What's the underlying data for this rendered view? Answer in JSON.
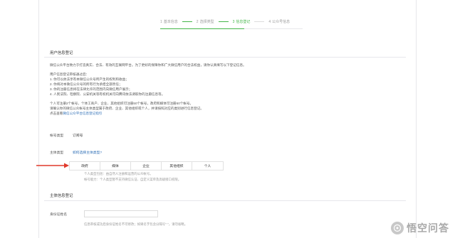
{
  "steps": [
    {
      "num": "1",
      "label": "基本信息"
    },
    {
      "num": "2",
      "label": "选择类型"
    },
    {
      "num": "3",
      "label": "信息登记"
    },
    {
      "num": "4",
      "label": "公众号信息"
    }
  ],
  "active_step": 3,
  "section_user": {
    "title": "用户信息登记",
    "intro": "微信公众平台致力于打造真实、合法、有效的互联网平台。为了更好的保障你和广大微信用户的合法权益，请你认真填写以下登记信息。",
    "notice_title": "用户信息登记审核通过后：",
    "notice_items": [
      "1. 你可以依法享有本微信公众号所产生的权利和收益；",
      "2. 你将对本微信公众号的所有行为承担全部责任；",
      "3. 你的注册信息将在法律允许的范围内向微信用户展示；",
      "4. 人民法院、检察院、公安机关等有权机关可向腾讯依法调取你的注册信息等。"
    ],
    "account_limit_1": "个人可注册2个帐号，个体工商户、企业、其他组织可注册50个帐号，政府和媒体可注册50个帐号。",
    "account_limit_2": "请确认你的微信公众帐号主体类型属于政府、企业、其他组织或个人，并请按照对应的类别进行信息登记。",
    "help_prefix": "点击查看",
    "help_link": "微信公众平台信息登记指引"
  },
  "account_type": {
    "label": "帐号类型",
    "value": "订阅号"
  },
  "subject_type": {
    "label": "主体类型",
    "link": "如何选择主体类型?",
    "options": [
      "政府",
      "媒体",
      "企业",
      "其他组织",
      "个人"
    ],
    "hint_1": "个人类型包括：由自然人注册和运营的公众帐号。",
    "hint_2": "帐号能力：个人类型暂不支持微信认证、自定义菜单及高级接口权限。"
  },
  "section_subject": {
    "title": "主体信息登记"
  },
  "id_field": {
    "label": "身份证姓名",
    "value": "",
    "placeholder": "",
    "hint": "信息审核成功后身份证姓名不可修改；如果名字包含分隔号\"·\"，请勿省略。"
  },
  "watermark": {
    "text": "悟空问答"
  },
  "colors": {
    "accent": "#44b549",
    "link": "#2f6fb6",
    "arrow": "#e0392b"
  }
}
